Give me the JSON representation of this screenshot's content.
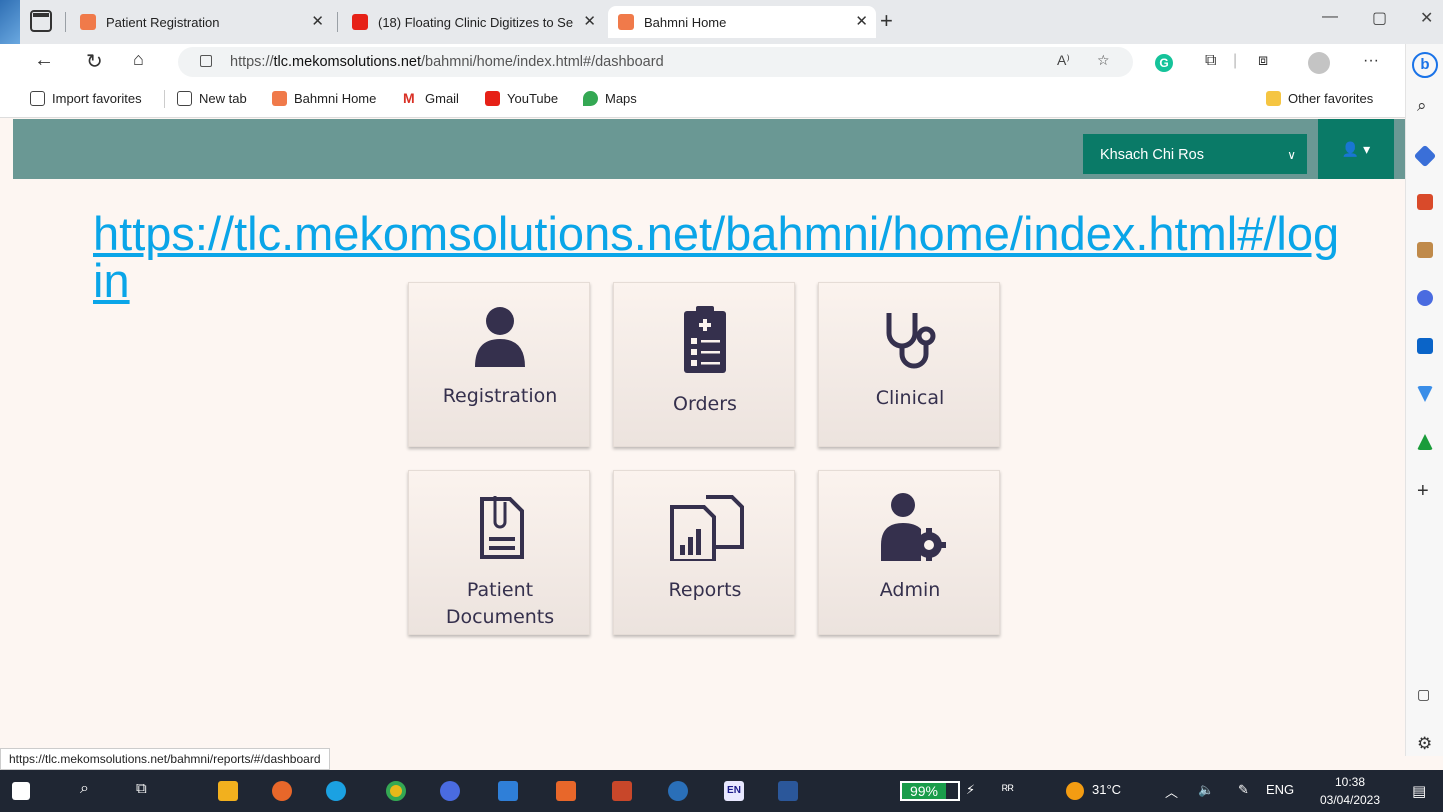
{
  "browser": {
    "tabs": [
      {
        "title": "Patient Registration",
        "active": false
      },
      {
        "title": "(18) Floating Clinic Digitizes to Se",
        "active": false
      },
      {
        "title": "Bahmni Home",
        "active": true
      }
    ],
    "address": {
      "prefix": "https://",
      "host": "tlc.mekomsolutions.net",
      "path": "/bahmni/home/index.html#/dashboard"
    },
    "favorites": [
      "Import favorites",
      "New tab",
      "Bahmni Home",
      "Gmail",
      "YouTube",
      "Maps"
    ],
    "other_favorites": "Other favorites",
    "status_url": "https://tlc.mekomsolutions.net/bahmni/reports/#/dashboard"
  },
  "app": {
    "location": "Khsach Chi Ros",
    "overlay_link": "https://tlc.mekomsolutions.net/bahmni/home/index.html#/login",
    "tiles": [
      {
        "label": "Registration",
        "icon": "user-icon"
      },
      {
        "label": "Orders",
        "icon": "clipboard-icon"
      },
      {
        "label": "Clinical",
        "icon": "stethoscope-icon"
      },
      {
        "label_line1": "Patient",
        "label_line2": "Documents",
        "icon": "document-icon"
      },
      {
        "label": "Reports",
        "icon": "reports-icon"
      },
      {
        "label": "Admin",
        "icon": "admin-icon"
      }
    ]
  },
  "taskbar": {
    "battery": "99%",
    "temperature": "31°C",
    "language": "ENG",
    "time": "10:38",
    "date": "03/04/2023"
  },
  "colors": {
    "header": "#6a9894",
    "accent": "#0a7a67",
    "tile_text": "#35304d",
    "link": "#0aa5e8"
  }
}
